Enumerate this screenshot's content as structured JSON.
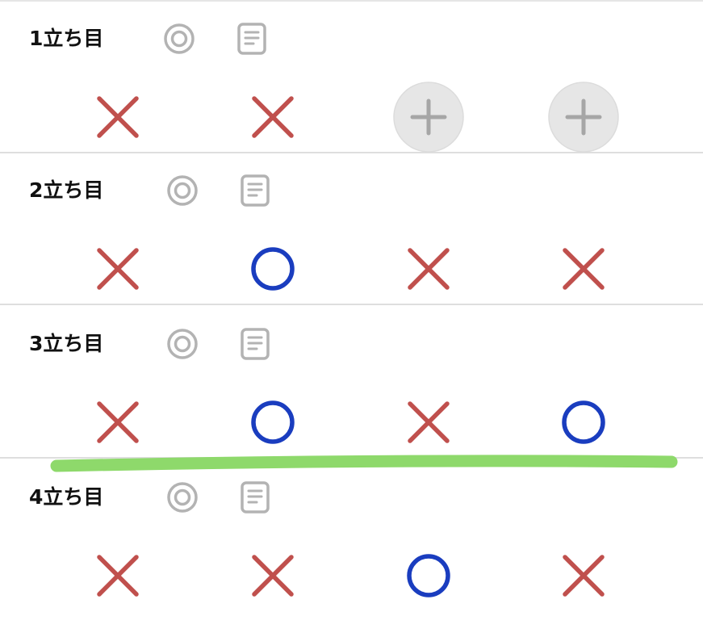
{
  "colors": {
    "cross": "#c0504d",
    "circle": "#1a3dbf",
    "icon_gray": "#b3b3b3",
    "add_bg": "#e6e6e6",
    "add_plus": "#a6a6a6",
    "highlight": "#8ed96b",
    "divider": "#dedede"
  },
  "icons": {
    "target": "double-circle-icon",
    "memo": "document-icon",
    "add": "plus-icon",
    "miss": "cross-icon",
    "hit": "circle-icon"
  },
  "sections": [
    {
      "title": "1立ち目",
      "results": [
        "miss",
        "miss",
        "add",
        "add"
      ]
    },
    {
      "title": "2立ち目",
      "results": [
        "miss",
        "hit",
        "miss",
        "miss"
      ]
    },
    {
      "title": "3立ち目",
      "results": [
        "miss",
        "hit",
        "miss",
        "hit"
      ]
    },
    {
      "title": "4立ち目",
      "results": [
        "miss",
        "miss",
        "hit",
        "miss"
      ]
    }
  ]
}
